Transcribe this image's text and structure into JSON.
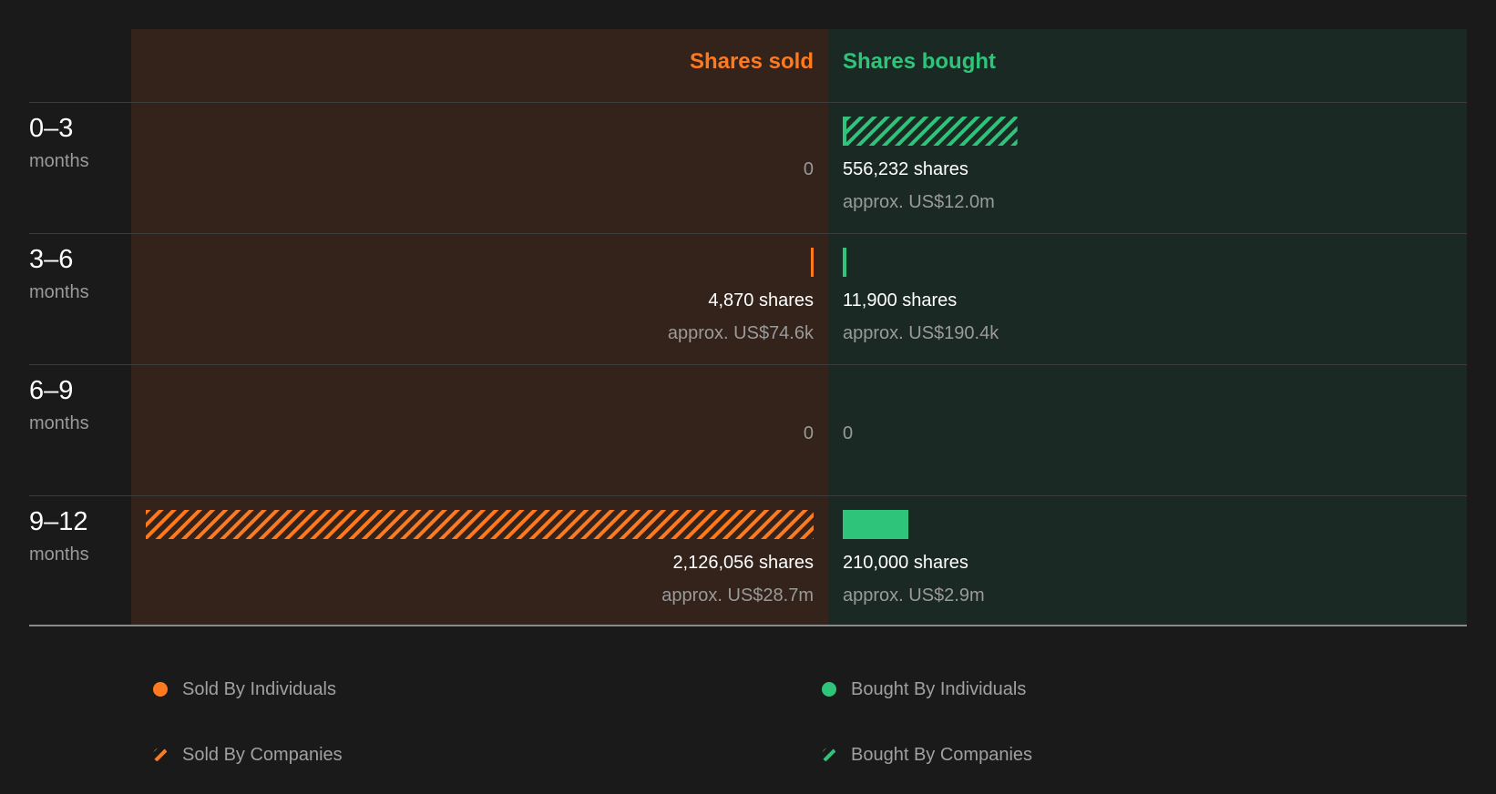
{
  "colors": {
    "sold": "#ff7a1f",
    "bought": "#2ec479",
    "sold_panel": "#33231a",
    "bought_panel": "#1b2924"
  },
  "chart_data": {
    "type": "bar",
    "orientation": "diverging-horizontal",
    "headers": {
      "sold": "Shares sold",
      "bought": "Shares bought"
    },
    "rows": [
      {
        "range": "0–3",
        "unit": "months",
        "sold": {
          "individuals": 0,
          "companies": 0,
          "zero_label": "0"
        },
        "bought": {
          "individuals": 12000,
          "companies": 544232,
          "shares_label": "556,232 shares",
          "approx_label": "approx. US$12.0m"
        }
      },
      {
        "range": "3–6",
        "unit": "months",
        "sold": {
          "individuals": 4870,
          "companies": 0,
          "shares_label": "4,870 shares",
          "approx_label": "approx. US$74.6k"
        },
        "bought": {
          "individuals": 11900,
          "companies": 0,
          "shares_label": "11,900 shares",
          "approx_label": "approx. US$190.4k"
        }
      },
      {
        "range": "6–9",
        "unit": "months",
        "sold": {
          "individuals": 0,
          "companies": 0,
          "zero_label": "0"
        },
        "bought": {
          "individuals": 0,
          "companies": 0,
          "zero_label": "0"
        }
      },
      {
        "range": "9–12",
        "unit": "months",
        "sold": {
          "individuals": 0,
          "companies": 2126056,
          "shares_label": "2,126,056 shares",
          "approx_label": "approx. US$28.7m"
        },
        "bought": {
          "individuals": 210000,
          "companies": 0,
          "shares_label": "210,000 shares",
          "approx_label": "approx. US$2.9m"
        }
      }
    ],
    "legend": [
      {
        "label": "Sold By Individuals",
        "side": "sold",
        "kind": "individuals"
      },
      {
        "label": "Sold By Companies",
        "side": "sold",
        "kind": "companies"
      },
      {
        "label": "Bought By Individuals",
        "side": "bought",
        "kind": "individuals"
      },
      {
        "label": "Bought By Companies",
        "side": "bought",
        "kind": "companies"
      }
    ]
  }
}
